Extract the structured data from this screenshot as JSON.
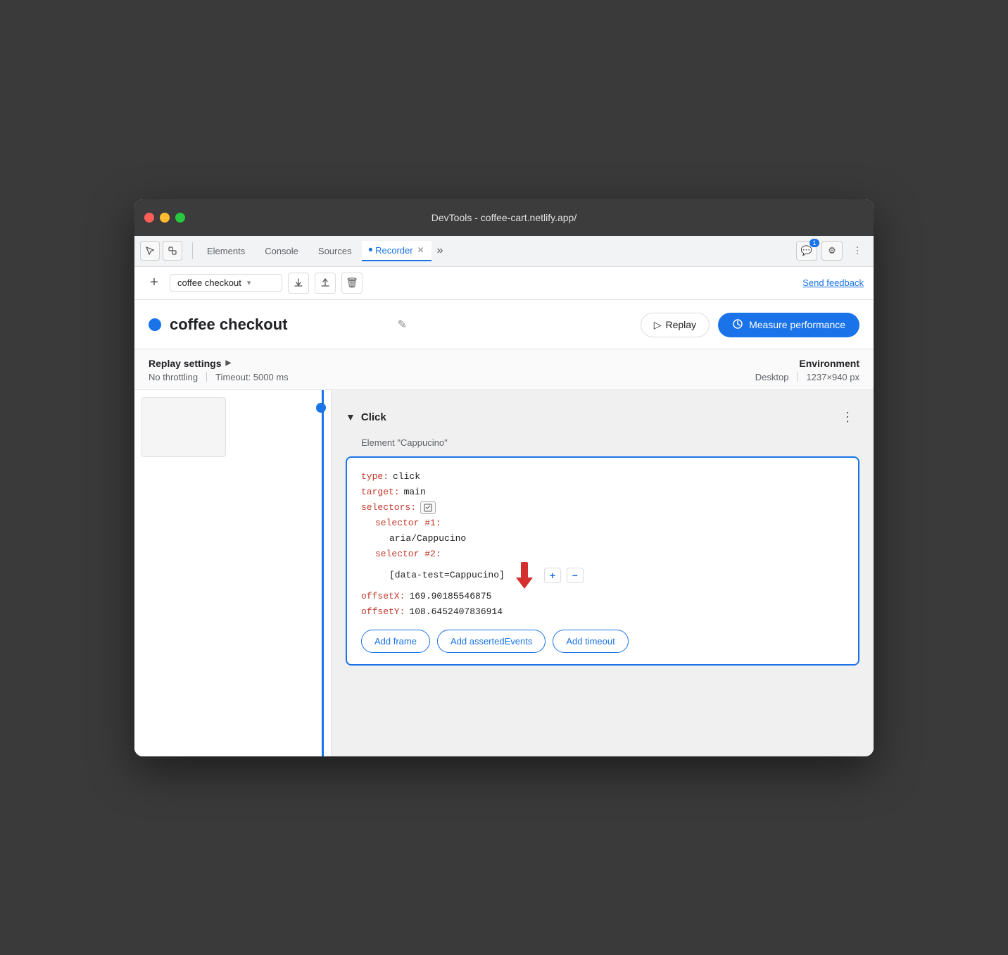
{
  "window": {
    "title": "DevTools - coffee-cart.netlify.app/"
  },
  "titlebar_buttons": {
    "close": "●",
    "min": "●",
    "max": "●"
  },
  "tabs": {
    "elements": "Elements",
    "console": "Console",
    "sources": "Sources",
    "recorder": "Recorder",
    "more": "»"
  },
  "tab_actions": {
    "chat_count": "1",
    "gear": "⚙",
    "dots": "⋮"
  },
  "toolbar": {
    "add_label": "+",
    "recording_name": "coffee checkout",
    "dropdown_arrow": "▾",
    "upload_label": "↑",
    "download_label": "↓",
    "delete_label": "🗑",
    "send_feedback": "Send feedback"
  },
  "header": {
    "title": "coffee checkout",
    "edit_icon": "✎",
    "replay_label": "Replay",
    "replay_icon": "▷",
    "measure_label": "Measure performance",
    "measure_icon": "↻"
  },
  "settings": {
    "label": "Replay settings",
    "triangle": "▶",
    "throttle": "No throttling",
    "timeout": "Timeout: 5000 ms",
    "env_label": "Environment",
    "env_device": "Desktop",
    "env_size": "1237×940 px"
  },
  "step": {
    "arrow": "▼",
    "name": "Click",
    "sub": "Element \"Cappucino\"",
    "more": "⋮",
    "code": {
      "type_key": "type:",
      "type_val": "click",
      "target_key": "target:",
      "target_val": "main",
      "selectors_key": "selectors:",
      "selector_icon": "⌖",
      "selector1_key": "selector #1:",
      "selector1_val": "aria/Cappucino",
      "selector2_key": "selector #2:",
      "selector2_val": "[data-test=Cappucino]",
      "offsetx_key": "offsetX:",
      "offsetx_val": "169.90185546875",
      "offsety_key": "offsetY:",
      "offsety_val": "108.6452407836914",
      "btn_plus": "+",
      "btn_minus": "−"
    },
    "btn_add_frame": "Add frame",
    "btn_add_events": "Add assertedEvents",
    "btn_add_timeout": "Add timeout"
  }
}
